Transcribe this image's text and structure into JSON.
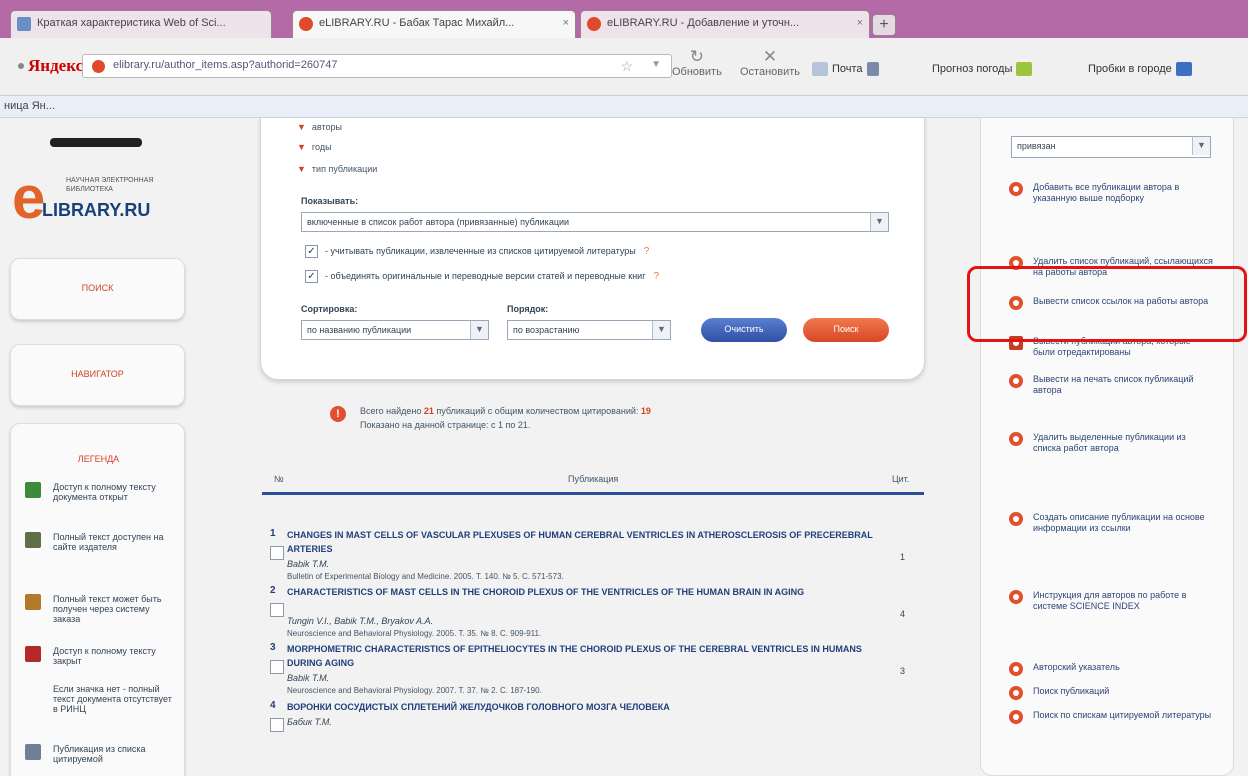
{
  "browser": {
    "tabs": [
      {
        "label": "Краткая характеристика Web of Sci..."
      },
      {
        "label": "eLIBRARY.RU - Бабак Тарас Михайл...",
        "close": "×"
      },
      {
        "label": "eLIBRARY.RU - Добавление и уточн...",
        "close": "×"
      }
    ],
    "new_tab": "+",
    "brand": "Яндекс",
    "url": "elibrary.ru/author_items.asp?authorid=260747",
    "url_star": "☆",
    "url_dropdown": "▼",
    "refresh_label": "Обновить",
    "stop_label": "Остановить",
    "mail_label": "Почта",
    "weather_label": "Прогноз погоды",
    "traffic_label": "Пробки в городе",
    "bookmark": "ница Ян..."
  },
  "sidebar": {
    "logo_small": "научная электронная библиотека",
    "logo_e": "e",
    "logo_text": "LIBRARY.RU",
    "btn_search": "поиск",
    "btn_navigator": "навигатор",
    "legend_title": "ЛЕГЕНДА",
    "legend_items": [
      {
        "text": "Доступ к полному тексту документа открыт",
        "color": "#3d8a3b"
      },
      {
        "text": "Полный текст доступен на сайте издателя",
        "color": "#5f6f48"
      },
      {
        "text": "Полный текст может быть получен через систему заказа",
        "color": "#b27a2a"
      },
      {
        "text": "Доступ к полному тексту закрыт",
        "color": "#b32a2a"
      },
      {
        "text": "Если значка нет - полный текст документа отсутствует в РИНЦ",
        "color": "#ffffff"
      },
      {
        "text": "Публикация из списка цитируемой",
        "color": "#6f7f96"
      }
    ]
  },
  "filter": {
    "criteria": [
      "авторы",
      "годы",
      "тип публикации"
    ],
    "show_label": "Показывать:",
    "show_value": "включенные в список работ автора (привязанные) публикации",
    "check1": "- учитывать публикации, извлеченные из списков цитируемой литературы",
    "check2": "- объединять оригинальные и переводные версии статей и переводные книг",
    "check_mark": "✓",
    "q_mark": "?",
    "sort_label": "Сортировка:",
    "sort_value": "по названию публикации",
    "order_label": "Порядок:",
    "order_value": "по возрастанию",
    "arrow": "▼",
    "btn_clear": "Очистить",
    "btn_search": "Поиск"
  },
  "summary": {
    "icon": "!",
    "prefix": "Всего найдено",
    "found": "21",
    "middle": "публикаций с общим количеством цитирований:",
    "citations": "19",
    "line2": "Показано на данной странице: с 1 по 21."
  },
  "table": {
    "col_num": "№",
    "col_pub": "Публикация",
    "col_cit": "Цит."
  },
  "publications": [
    {
      "num": "1",
      "title": "CHANGES IN MAST CELLS OF VASCULAR PLEXUSES OF HUMAN CEREBRAL VENTRICLES IN ATHEROSCLEROSIS OF PRECEREBRAL ARTERIES",
      "authors": "Babik T.M.",
      "source": "Bulletin of Experimental Biology and Medicine. 2005. Т. 140. № 5. С. 571-573.",
      "citations": "1"
    },
    {
      "num": "2",
      "title": "CHARACTERISTICS OF MAST CELLS IN THE CHOROID PLEXUS OF THE VENTRICLES OF THE HUMAN BRAIN IN AGING",
      "authors": "Tungin V.I., Babik T.M., Bryakov A.A.",
      "source": "Neuroscience and Behavioral Physiology. 2005. Т. 35. № 8. С. 909-911.",
      "citations": "4"
    },
    {
      "num": "3",
      "title": "MORPHOMETRIC CHARACTERISTICS OF EPITHELIOCYTES IN THE CHOROID PLEXUS OF THE CEREBRAL VENTRICLES IN HUMANS DURING AGING",
      "authors": "Babik T.M.",
      "source": "Neuroscience and Behavioral Physiology. 2007. Т. 37. № 2. С. 187-190.",
      "citations": "3"
    },
    {
      "num": "4",
      "title": "ВОРОНКИ СОСУДИСТЫХ СПЛЕТЕНИЙ ЖЕЛУДОЧКОВ ГОЛОВНОГО МОЗГА ЧЕЛОВЕКА",
      "authors": "Бабик Т.М.",
      "source": "",
      "citations": ""
    }
  ],
  "right_panel": {
    "select_value": "привязан",
    "select_arrow": "▼",
    "actions": [
      "Добавить все публикации автора в указанную выше подборку",
      "Удалить список публикаций, ссылающихся на работы автора",
      "Вывести список ссылок на работы автора",
      "Вывести публикации автора, которые были отредактированы",
      "Вывести на печать список публикаций автора",
      "Удалить выделенные публикации из списка работ автора",
      "Создать описание публикации на основе информации из ссылки",
      "Инструкция для авторов по работе в системе SCIENCE INDEX",
      "Авторский указатель",
      "Поиск публикаций",
      "Поиск по спискам цитируемой литературы"
    ]
  }
}
